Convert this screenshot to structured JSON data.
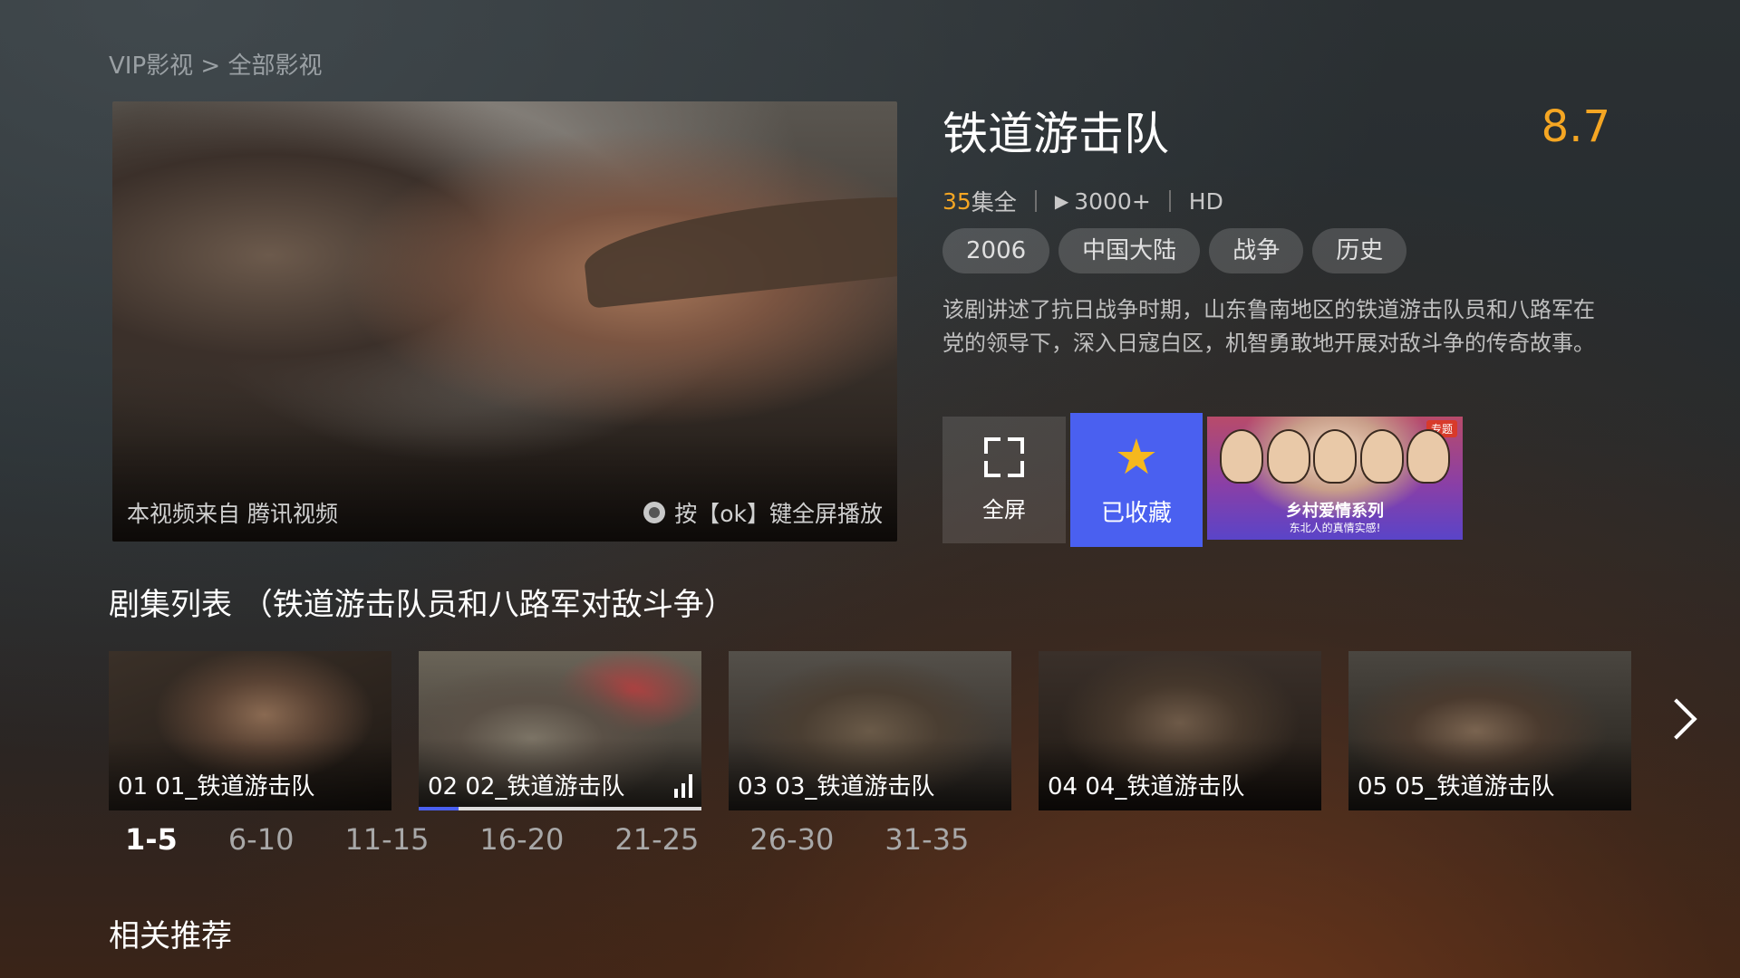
{
  "breadcrumb": "VIP影视 > 全部影视",
  "preview": {
    "source_text": "本视频来自 腾讯视频",
    "hint_text": "按【ok】键全屏播放"
  },
  "show": {
    "title": "铁道游击队",
    "score": "8.7",
    "episode_count": "35",
    "episode_count_suffix": "集全",
    "plays": "3000+",
    "quality": "HD",
    "tags": [
      "2006",
      "中国大陆",
      "战争",
      "历史"
    ],
    "description": "该剧讲述了抗日战争时期，山东鲁南地区的铁道游击队员和八路军在党的领导下，深入日寇白区，机智勇敢地开展对敌斗争的传奇故事。"
  },
  "actions": {
    "fullscreen_label": "全屏",
    "favorite_label": "已收藏",
    "promo_badge": "专题",
    "promo_title": "乡村爱情系列",
    "promo_subtitle": "东北人的真情实感!"
  },
  "episodes_section": {
    "title": "剧集列表 （铁道游击队员和八路军对敌斗争）",
    "items": [
      {
        "label": "01 01_铁道游击队"
      },
      {
        "label": "02 02_铁道游击队",
        "playing": true,
        "progress": 0.14
      },
      {
        "label": "03 03_铁道游击队"
      },
      {
        "label": "04 04_铁道游击队"
      },
      {
        "label": "05 05_铁道游击队"
      }
    ],
    "ranges": [
      "1-5",
      "6-10",
      "11-15",
      "16-20",
      "21-25",
      "26-30",
      "31-35"
    ],
    "active_range": "1-5"
  },
  "related_title": "相关推荐",
  "colors": {
    "accent_blue": "#4a60f0",
    "score_orange": "#f5a623",
    "star_yellow": "#f5b81e"
  }
}
